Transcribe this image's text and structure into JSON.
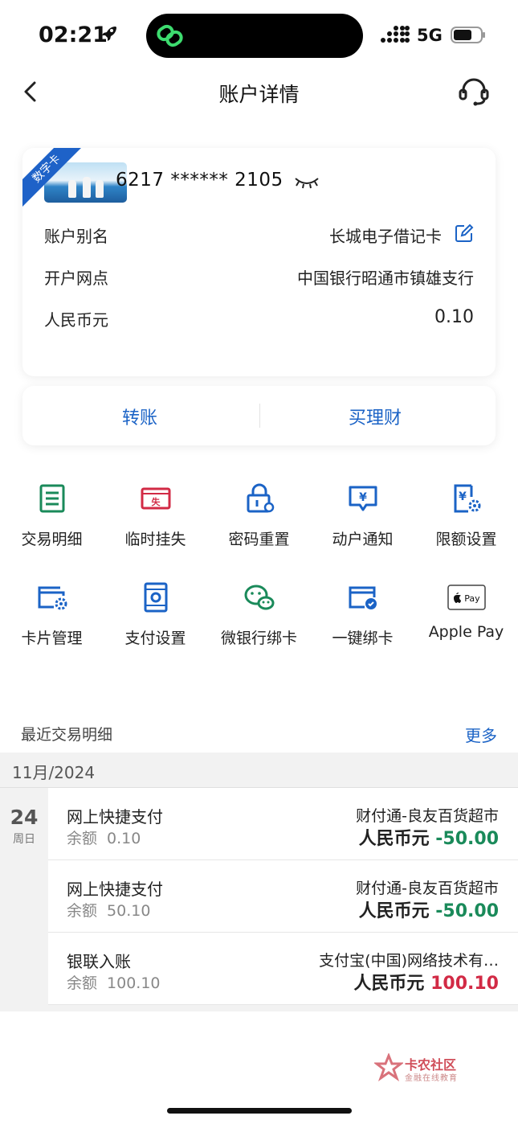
{
  "status": {
    "time": "02:21",
    "network": "5G"
  },
  "nav": {
    "title": "账户详情"
  },
  "card": {
    "badge": "数字卡",
    "number": "6217 ****** 2105",
    "rows": [
      {
        "label": "账户别名",
        "value": "长城电子借记卡"
      },
      {
        "label": "开户网点",
        "value": "中国银行昭通市镇雄支行"
      },
      {
        "label": "人民币元",
        "value": "0.10"
      }
    ]
  },
  "actions": {
    "transfer": "转账",
    "wealth": "买理财"
  },
  "grid": [
    {
      "label": "交易明细",
      "icon": "transaction-list-icon",
      "color": "#1a8a5a"
    },
    {
      "label": "临时挂失",
      "icon": "report-loss-icon",
      "color": "#d22a45"
    },
    {
      "label": "密码重置",
      "icon": "password-reset-icon",
      "color": "#1b63c6"
    },
    {
      "label": "动户通知",
      "icon": "account-notify-icon",
      "color": "#1b63c6"
    },
    {
      "label": "限额设置",
      "icon": "limit-settings-icon",
      "color": "#1b63c6"
    },
    {
      "label": "卡片管理",
      "icon": "card-manage-icon",
      "color": "#1b63c6"
    },
    {
      "label": "支付设置",
      "icon": "pay-settings-icon",
      "color": "#1b63c6"
    },
    {
      "label": "微银行绑卡",
      "icon": "wechat-bind-icon",
      "color": "#1a8a5a"
    },
    {
      "label": "一键绑卡",
      "icon": "quick-bind-icon",
      "color": "#1b63c6"
    },
    {
      "label": "Apple Pay",
      "icon": "apple-pay-icon",
      "color": "#222222"
    }
  ],
  "recent": {
    "title": "最近交易明细",
    "more": "更多",
    "month": "11月/2024",
    "day": "24",
    "weekday": "周日",
    "items": [
      {
        "type": "网上快捷支付",
        "balance_label": "余额",
        "balance": "0.10",
        "merchant": "财付通-良友百货超市",
        "currency": "人民币元",
        "amount": "-50.00"
      },
      {
        "type": "网上快捷支付",
        "balance_label": "余额",
        "balance": "50.10",
        "merchant": "财付通-良友百货超市",
        "currency": "人民币元",
        "amount": "-50.00"
      },
      {
        "type": "银联入账",
        "balance_label": "余额",
        "balance": "100.10",
        "merchant": "支付宝(中国)网络技术有…",
        "currency": "人民币元",
        "amount": "100.10"
      }
    ]
  },
  "watermark": {
    "name": "卡农社区",
    "sub": "金融在线教育"
  }
}
